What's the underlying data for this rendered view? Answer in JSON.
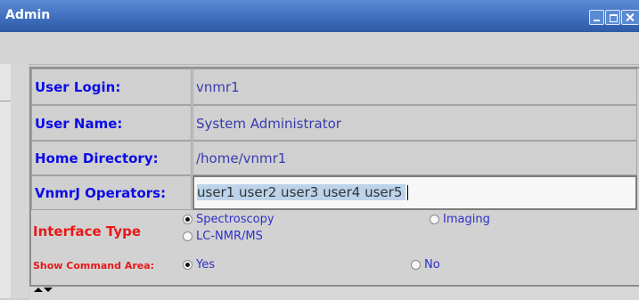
{
  "window": {
    "title": "Admin"
  },
  "form": {
    "user_login": {
      "label": "User Login:",
      "value": "vnmr1"
    },
    "user_name": {
      "label": "User Name:",
      "value": "System Administrator"
    },
    "home_directory": {
      "label": "Home Directory:",
      "value": "/home/vnmr1"
    },
    "operators": {
      "label": "VnmrJ Operators:",
      "value": "user1 user2 user3 user4 user5"
    },
    "interface_type": {
      "label": "Interface Type",
      "options": [
        {
          "label": "Spectroscopy",
          "selected": true
        },
        {
          "label": "LC-NMR/MS",
          "selected": false
        },
        {
          "label": "Imaging",
          "selected": false
        }
      ]
    },
    "show_command_area": {
      "label": "Show Command Area:",
      "options": [
        {
          "label": "Yes",
          "selected": true
        },
        {
          "label": "No",
          "selected": false
        }
      ]
    }
  },
  "colors": {
    "titlebar": "#3f6fbe",
    "label_blue": "#0c0ce6",
    "label_red": "#e81818",
    "value_text": "#3a3aaf"
  },
  "icons": [
    "minimize-icon",
    "maximize-icon",
    "close-icon",
    "collapse-left-icon",
    "expand-right-icon",
    "collapse-up-icon",
    "expand-down-icon"
  ]
}
